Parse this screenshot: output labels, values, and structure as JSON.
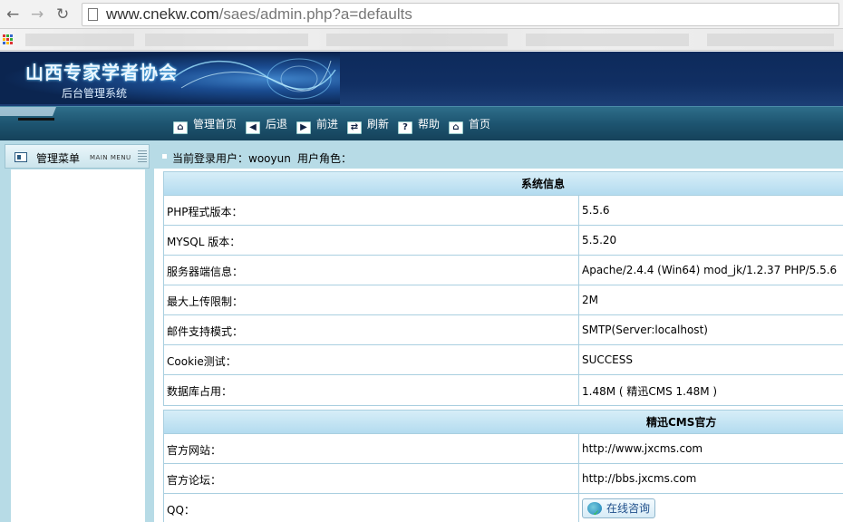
{
  "browser": {
    "url_host": "www.cnekw.com",
    "url_path": "/saes/admin.php?a=defaults"
  },
  "header": {
    "site_title": "山西专家学者协会",
    "subtitle": "后台管理系统"
  },
  "toolbar": {
    "items": [
      {
        "label": "管理首页",
        "icon": "home-icon"
      },
      {
        "label": "后退",
        "icon": "back-arrow-icon"
      },
      {
        "label": "前进",
        "icon": "forward-arrow-icon"
      },
      {
        "label": "刷新",
        "icon": "refresh-icon"
      },
      {
        "label": "帮助",
        "icon": "help-icon"
      },
      {
        "label": "首页",
        "icon": "home-icon"
      }
    ]
  },
  "sidebar": {
    "title": "管理菜单",
    "title_en": "MAIN MENU"
  },
  "userbar": {
    "current_user_label": "当前登录用户：wooyun",
    "role_label": "用户角色："
  },
  "system_info": {
    "title": "系统信息",
    "rows": [
      {
        "key": "PHP程式版本：",
        "value": "5.5.6"
      },
      {
        "key": "MYSQL 版本：",
        "value": "5.5.20"
      },
      {
        "key": "服务器端信息：",
        "value": "Apache/2.4.4 (Win64) mod_jk/1.2.37 PHP/5.5.6"
      },
      {
        "key": "最大上传限制：",
        "value": "2M"
      },
      {
        "key": "邮件支持模式：",
        "value": "SMTP(Server:localhost)"
      },
      {
        "key": "Cookie测试：",
        "value": "SUCCESS"
      },
      {
        "key": "数据库占用：",
        "value": "1.48M ( 精迅CMS 1.48M )"
      }
    ]
  },
  "official": {
    "title": "精迅CMS官方",
    "rows": [
      {
        "key": "官方网站：",
        "value": "http://www.jxcms.com"
      },
      {
        "key": "官方论坛：",
        "value": "http://bbs.jxcms.com"
      },
      {
        "key": "QQ：",
        "value": "在线咨询"
      }
    ]
  }
}
